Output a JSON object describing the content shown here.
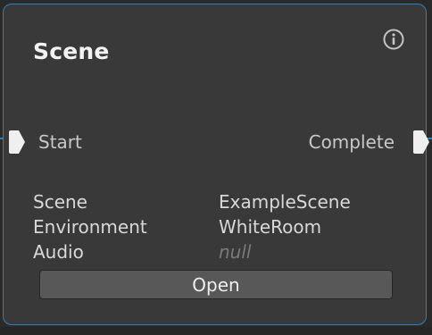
{
  "node": {
    "title": "Scene",
    "info_icon": "info-icon",
    "ports": {
      "input_label": "Start",
      "output_label": "Complete"
    },
    "properties": [
      {
        "key": "Scene",
        "value": "ExampleScene",
        "is_null": false
      },
      {
        "key": "Environment",
        "value": "WhiteRoom",
        "is_null": false
      },
      {
        "key": "Audio",
        "value": "null",
        "is_null": true
      }
    ],
    "open_button_label": "Open"
  },
  "colors": {
    "background": "#202020",
    "node_body": "#393939",
    "selection_border": "#2f80b6",
    "button": "#585858",
    "text": "#d8d8d8",
    "null_text": "#7a7a7a"
  }
}
